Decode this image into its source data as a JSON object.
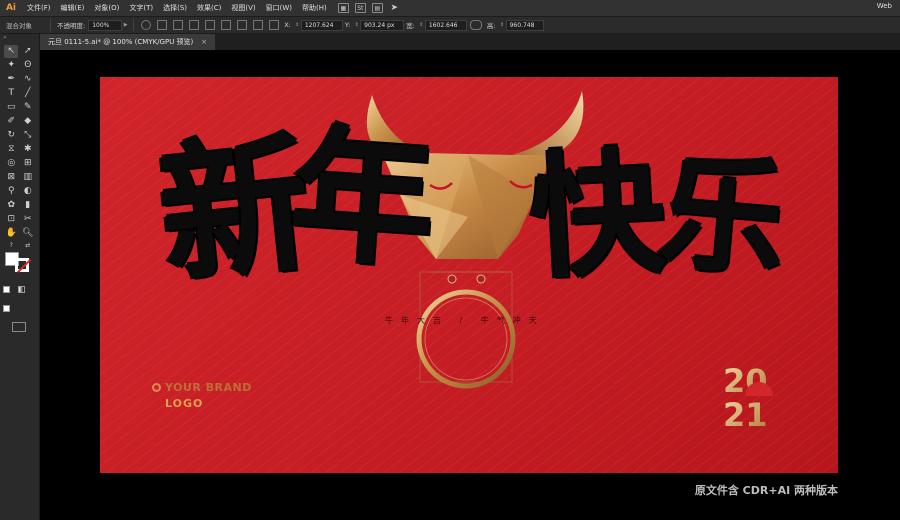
{
  "app": {
    "logo": "Ai",
    "workspace": "Web"
  },
  "menus": [
    "文件(F)",
    "编辑(E)",
    "对象(O)",
    "文字(T)",
    "选择(S)",
    "效果(C)",
    "视图(V)",
    "窗口(W)",
    "帮助(H)"
  ],
  "control_bar": {
    "selection": "混合对象",
    "opacity_label": "不透明度:",
    "opacity_value": "100%",
    "x_label": "X:",
    "x_value": "1207.624",
    "y_label": "Y:",
    "y_value": "903.24 px",
    "w_label": "宽:",
    "w_value": "1602.646",
    "h_label": "高:",
    "h_value": "960.748"
  },
  "document_tab": {
    "title": "元旦 0111-5.ai* @ 100% (CMYK/GPU 预览)",
    "close": "×"
  },
  "artwork": {
    "chars": [
      "新",
      "年",
      "快",
      "乐"
    ],
    "slogan": "牛年大吉 / 牛气冲天",
    "brand_name": "YOUR BRAND",
    "brand_logo": "LOGO",
    "year_top": "20",
    "year_bottom": "21"
  },
  "caption": "原文件含 CDR+AI 两种版本",
  "icons": [
    "selection-tool-icon",
    "direct-selection-tool-icon",
    "pen-tool-icon",
    "type-tool-icon",
    "line-tool-icon",
    "rectangle-tool-icon",
    "hand-tool-icon",
    "zoom-tool-icon"
  ],
  "colors": {
    "artboard_red": "#c51d24",
    "gold": "#d7a350",
    "ui_dark": "#2b2b2b"
  }
}
